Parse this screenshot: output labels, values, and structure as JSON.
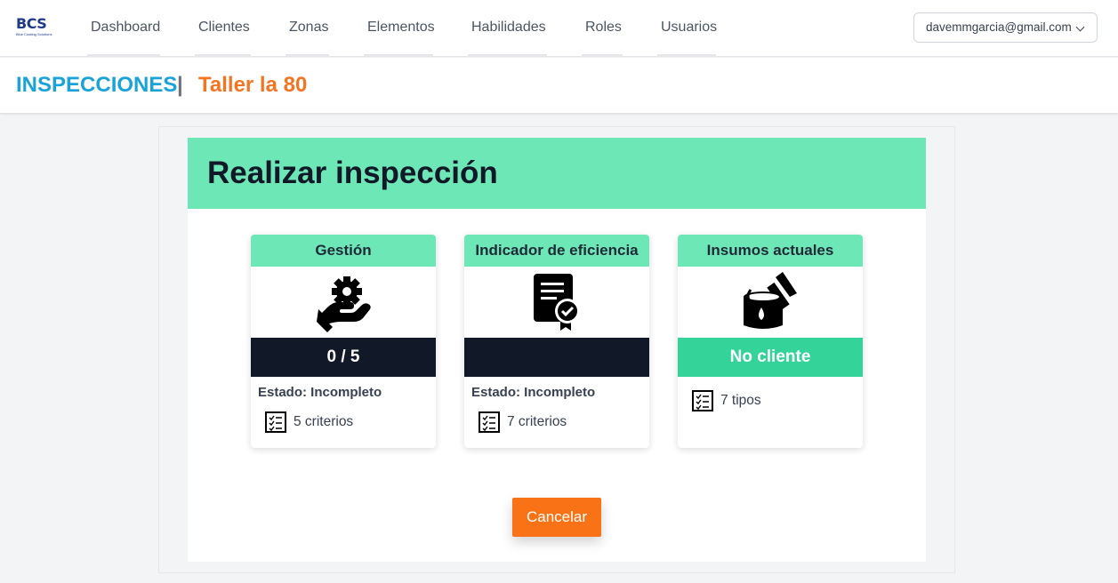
{
  "brand": {
    "name": "BCS",
    "tagline": "Blue Coating Solutions"
  },
  "nav": {
    "items": [
      {
        "label": "Dashboard"
      },
      {
        "label": "Clientes"
      },
      {
        "label": "Zonas"
      },
      {
        "label": "Elementos"
      },
      {
        "label": "Habilidades"
      },
      {
        "label": "Roles"
      },
      {
        "label": "Usuarios"
      }
    ],
    "user_email": "davemmgarcia@gmail.com"
  },
  "header": {
    "title": "INSPECCIONES",
    "separator": "|",
    "subtitle": "Taller la 80"
  },
  "panel": {
    "title": "Realizar inspección"
  },
  "cards": [
    {
      "title": "Gestión",
      "icon": "hand-gear-icon",
      "band": "0 / 5",
      "band_color": "#111827",
      "status": "Estado: Incompleto",
      "count": "5 criterios"
    },
    {
      "title": "Indicador de eficiencia",
      "icon": "certificate-document-icon",
      "band": "",
      "band_color": "#111827",
      "status": "Estado: Incompleto",
      "count": "7 criterios"
    },
    {
      "title": "Insumos actuales",
      "icon": "paint-bucket-brush-icon",
      "band": "No cliente",
      "band_color": "#34d399",
      "status": "",
      "count": "7 tipos"
    }
  ],
  "cancel_label": "Cancelar",
  "colors": {
    "accent_green": "#6ee7b7",
    "band_dark": "#111827",
    "band_green": "#34d399",
    "title_blue": "#1aa3d9",
    "subtitle_orange": "#f47521",
    "cancel_orange": "#f97316"
  }
}
